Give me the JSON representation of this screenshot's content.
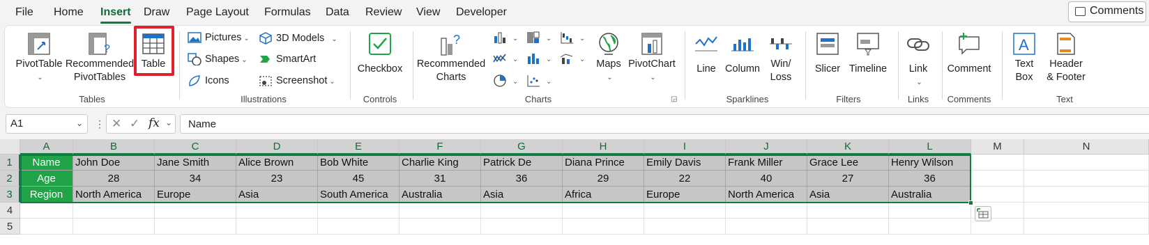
{
  "menu": {
    "tabs": [
      "File",
      "Home",
      "Insert",
      "Draw",
      "Page Layout",
      "Formulas",
      "Data",
      "Review",
      "View",
      "Developer"
    ],
    "active": "Insert",
    "comments": "Comments"
  },
  "ribbon": {
    "tables": {
      "pivot": "PivotTable",
      "recommended_1": "Recommended",
      "recommended_2": "PivotTables",
      "table": "Table",
      "group": "Tables"
    },
    "illustrations": {
      "pictures": "Pictures",
      "shapes": "Shapes",
      "icons": "Icons",
      "models": "3D Models",
      "smartart": "SmartArt",
      "screenshot": "Screenshot",
      "group": "Illustrations"
    },
    "controls": {
      "checkbox": "Checkbox",
      "group": "Controls"
    },
    "charts": {
      "rec_1": "Recommended",
      "rec_2": "Charts",
      "maps": "Maps",
      "pivotchart": "PivotChart",
      "group": "Charts"
    },
    "sparklines": {
      "line": "Line",
      "column": "Column",
      "winloss_1": "Win/",
      "winloss_2": "Loss",
      "group": "Sparklines"
    },
    "filters": {
      "slicer": "Slicer",
      "timeline": "Timeline",
      "group": "Filters"
    },
    "links": {
      "link": "Link",
      "group": "Links"
    },
    "comments": {
      "comment": "Comment",
      "group": "Comments"
    },
    "text": {
      "textbox_1": "Text",
      "textbox_2": "Box",
      "header_1": "Header",
      "header_2": "& Footer",
      "group": "Text"
    }
  },
  "formula_bar": {
    "cell_ref": "A1",
    "fx": "fx",
    "value": "Name"
  },
  "columns": [
    "A",
    "B",
    "C",
    "D",
    "E",
    "F",
    "G",
    "H",
    "I",
    "J",
    "K",
    "L",
    "M",
    "N"
  ],
  "rows": [
    "1",
    "2",
    "3",
    "4",
    "5"
  ],
  "sheet": [
    [
      "Name",
      "John Doe",
      "Jane Smith",
      "Alice Brown",
      "Bob White",
      "Charlie King",
      "Patrick De",
      "Diana Prince",
      "Emily Davis",
      "Frank Miller",
      "Grace Lee",
      "Henry Wilson"
    ],
    [
      "Age",
      "28",
      "34",
      "23",
      "45",
      "31",
      "36",
      "29",
      "22",
      "40",
      "27",
      "36"
    ],
    [
      "Region",
      "North America",
      "Europe",
      "Asia",
      "South America",
      "Australia",
      "Asia",
      "Africa",
      "Europe",
      "North America",
      "Asia",
      "Australia"
    ]
  ],
  "colors": {
    "accent": "#107c41",
    "header_fill": "#21a348",
    "highlight": "#e0202a"
  }
}
